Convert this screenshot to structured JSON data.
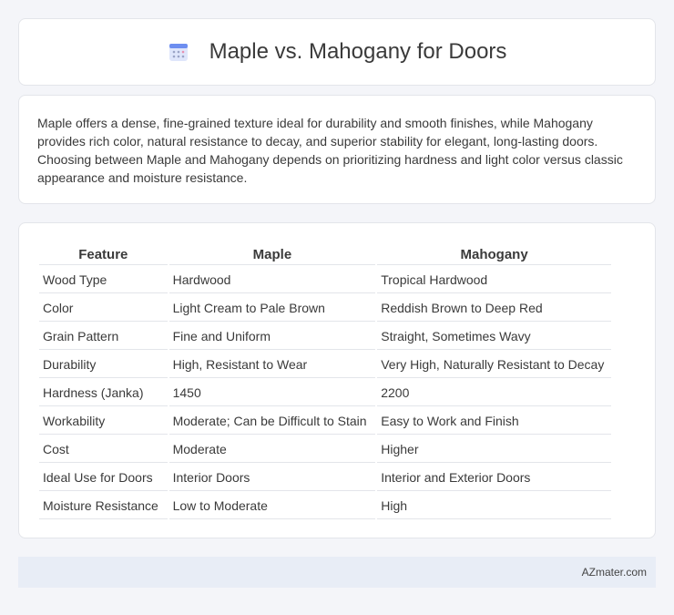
{
  "header": {
    "title": "Maple vs. Mahogany for Doors",
    "icon": "calendar-icon"
  },
  "description": "Maple offers a dense, fine-grained texture ideal for durability and smooth finishes, while Mahogany provides rich color, natural resistance to decay, and superior stability for elegant, long-lasting doors. Choosing between Maple and Mahogany depends on prioritizing hardness and light color versus classic appearance and moisture resistance.",
  "table": {
    "headers": [
      "Feature",
      "Maple",
      "Mahogany"
    ],
    "rows": [
      [
        "Wood Type",
        "Hardwood",
        "Tropical Hardwood"
      ],
      [
        "Color",
        "Light Cream to Pale Brown",
        "Reddish Brown to Deep Red"
      ],
      [
        "Grain Pattern",
        "Fine and Uniform",
        "Straight, Sometimes Wavy"
      ],
      [
        "Durability",
        "High, Resistant to Wear",
        "Very High, Naturally Resistant to Decay"
      ],
      [
        "Hardness (Janka)",
        "1450",
        "2200"
      ],
      [
        "Workability",
        "Moderate; Can be Difficult to Stain",
        "Easy to Work and Finish"
      ],
      [
        "Cost",
        "Moderate",
        "Higher"
      ],
      [
        "Ideal Use for Doors",
        "Interior Doors",
        "Interior and Exterior Doors"
      ],
      [
        "Moisture Resistance",
        "Low to Moderate",
        "High"
      ]
    ]
  },
  "footer": {
    "source": "AZmater.com"
  }
}
